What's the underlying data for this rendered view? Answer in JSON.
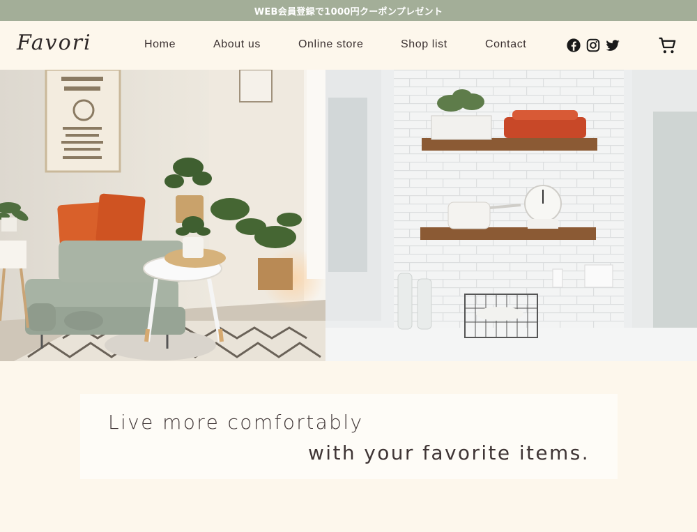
{
  "promo": {
    "text": "WEB会員登録で1000円クーポンプレゼント"
  },
  "header": {
    "logo": "Favori",
    "nav": [
      {
        "label": "Home"
      },
      {
        "label": "About us"
      },
      {
        "label": "Online store"
      },
      {
        "label": "Shop list"
      },
      {
        "label": "Contact"
      }
    ],
    "social_icons": [
      "facebook-icon",
      "instagram-icon",
      "twitter-icon"
    ],
    "cart_icon": "cart-icon"
  },
  "hero": {
    "left_photo": "living room with sofa, orange cushions, plants and round table",
    "right_photo": "kitchen with white tile wall and wooden shelves"
  },
  "tagline": {
    "line1": "Live more comfortably",
    "line2": "with your favorite items."
  },
  "colors": {
    "promo_bg": "#a3ae98",
    "page_bg": "#fdf7ec",
    "text": "#3a3030",
    "accent_orange": "#d9602a"
  }
}
